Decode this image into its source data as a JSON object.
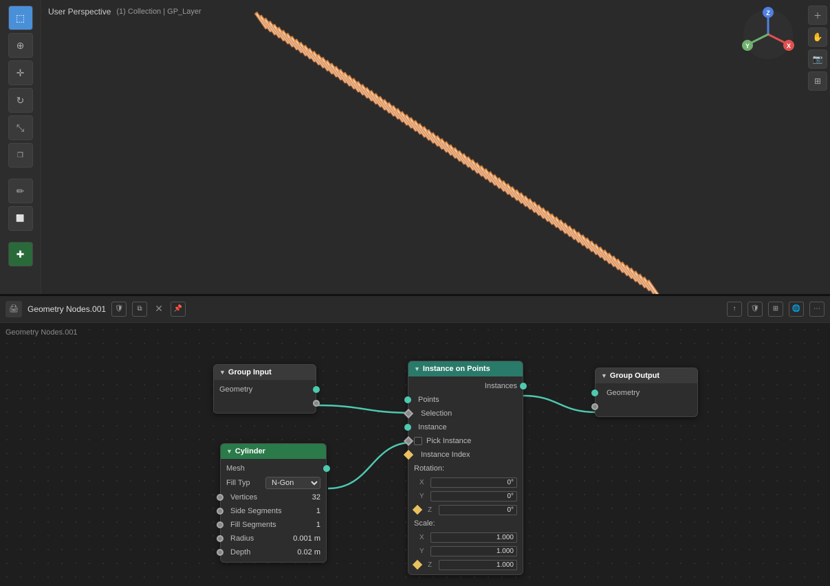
{
  "viewport": {
    "title": "User Perspective",
    "subtitle": "(1) Collection | GP_Layer",
    "background_color": "#2a2a2a"
  },
  "toolbar_left": {
    "buttons": [
      {
        "id": "select",
        "icon": "⬚",
        "active": true
      },
      {
        "id": "cursor",
        "icon": "⊕"
      },
      {
        "id": "move",
        "icon": "✛"
      },
      {
        "id": "rotate",
        "icon": "↻"
      },
      {
        "id": "scale",
        "icon": "⤡"
      },
      {
        "id": "transform",
        "icon": "❒"
      },
      {
        "id": "annotate",
        "icon": "✏"
      },
      {
        "id": "measure",
        "icon": "📐"
      },
      {
        "id": "add",
        "icon": "＋"
      }
    ]
  },
  "node_editor": {
    "header": {
      "icon": "🖨",
      "name": "Geometry Nodes.001",
      "buttons": [
        "shield",
        "copy",
        "close",
        "pin"
      ]
    },
    "breadcrumb": "Geometry Nodes.001",
    "nodes": {
      "group_input": {
        "title": "Group Input",
        "rows": [
          {
            "label": "Geometry",
            "socket_type": "teal",
            "socket_side": "out"
          }
        ],
        "extra_socket": true
      },
      "cylinder": {
        "title": "Cylinder",
        "rows": [
          {
            "label": "Mesh",
            "socket_type": "teal",
            "socket_side": "out"
          },
          {
            "label": "Fill Type",
            "value": "N-Gon"
          },
          {
            "label": "Vertices",
            "value": "32"
          },
          {
            "label": "Side Segments",
            "value": "1"
          },
          {
            "label": "Fill Segments",
            "value": "1"
          },
          {
            "label": "Radius",
            "value": "0.001 m"
          },
          {
            "label": "Depth",
            "value": "0.02 m"
          }
        ]
      },
      "instance_on_points": {
        "title": "Instance on Points",
        "inputs": [
          {
            "label": "Points",
            "socket_type": "teal"
          },
          {
            "label": "Selection",
            "socket_type": "yellow_diamond"
          },
          {
            "label": "Instance",
            "socket_type": "teal"
          },
          {
            "label": "Pick Instance",
            "socket_type": "checkbox"
          },
          {
            "label": "Instance Index",
            "socket_type": "yellow_diamond"
          }
        ],
        "rotation_section": {
          "label": "Rotation:",
          "axes": [
            {
              "axis": "X",
              "value": "0°"
            },
            {
              "axis": "Y",
              "value": "0°"
            },
            {
              "axis": "Z",
              "value": "0°"
            }
          ]
        },
        "scale_section": {
          "label": "Scale:",
          "axes": [
            {
              "axis": "X",
              "value": "1.000"
            },
            {
              "axis": "Y",
              "value": "1.000"
            },
            {
              "axis": "Z",
              "value": "1.000"
            }
          ]
        },
        "output": {
          "label": "Instances",
          "socket_type": "teal"
        }
      },
      "group_output": {
        "title": "Group Output",
        "rows": [
          {
            "label": "Geometry",
            "socket_type": "teal",
            "socket_side": "in"
          }
        ],
        "extra_socket": true
      }
    },
    "accent_color": "#4ec9b0"
  },
  "gizmo": {
    "x_color": "#e05050",
    "y_color": "#70b070",
    "z_color": "#5080e0",
    "labels": {
      "x": "X",
      "y": "Y",
      "z": "Z"
    }
  }
}
